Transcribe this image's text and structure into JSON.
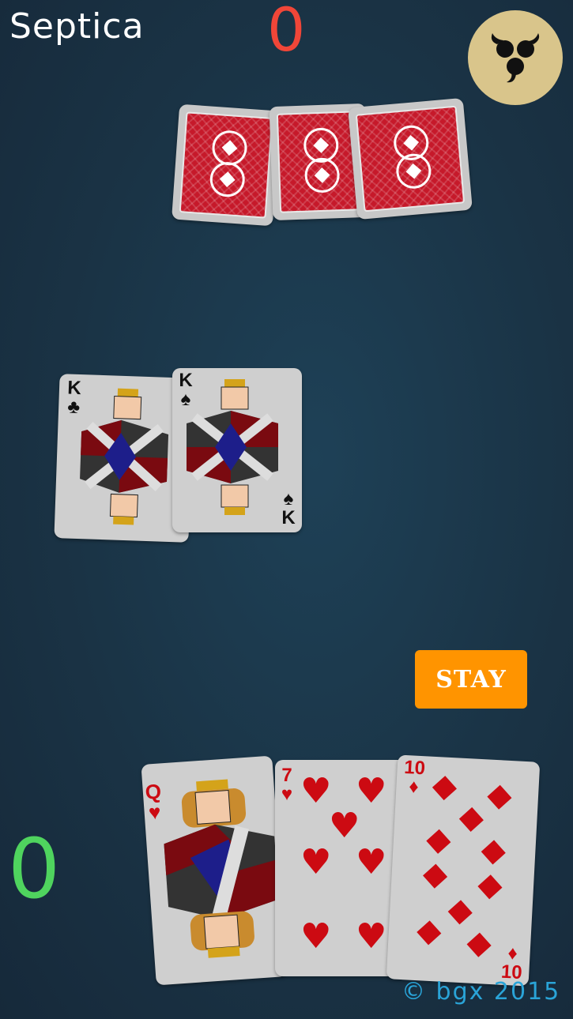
{
  "header": {
    "title": "Septica",
    "opponent_score": "0"
  },
  "player": {
    "score": "0"
  },
  "menu": {
    "icon": "triskelion-icon"
  },
  "opponent_hand": {
    "count": 3,
    "card_back": "red-pattern"
  },
  "table": {
    "cards": [
      {
        "rank": "K",
        "suit": "♣",
        "suit_name": "clubs"
      },
      {
        "rank": "K",
        "suit": "♠",
        "suit_name": "spades"
      }
    ]
  },
  "player_hand": {
    "cards": [
      {
        "rank": "Q",
        "suit": "♥",
        "suit_name": "hearts"
      },
      {
        "rank": "7",
        "suit": "♥",
        "suit_name": "hearts"
      },
      {
        "rank": "10",
        "suit": "♦",
        "suit_name": "diamonds"
      }
    ]
  },
  "actions": {
    "stay_label": "STAY"
  },
  "footer": {
    "copyright": "© bgx 2015"
  },
  "colors": {
    "opponent_score": "#f04638",
    "player_score": "#4fd45e",
    "stay_button": "#ff9400",
    "card_red": "#cc0a12"
  }
}
